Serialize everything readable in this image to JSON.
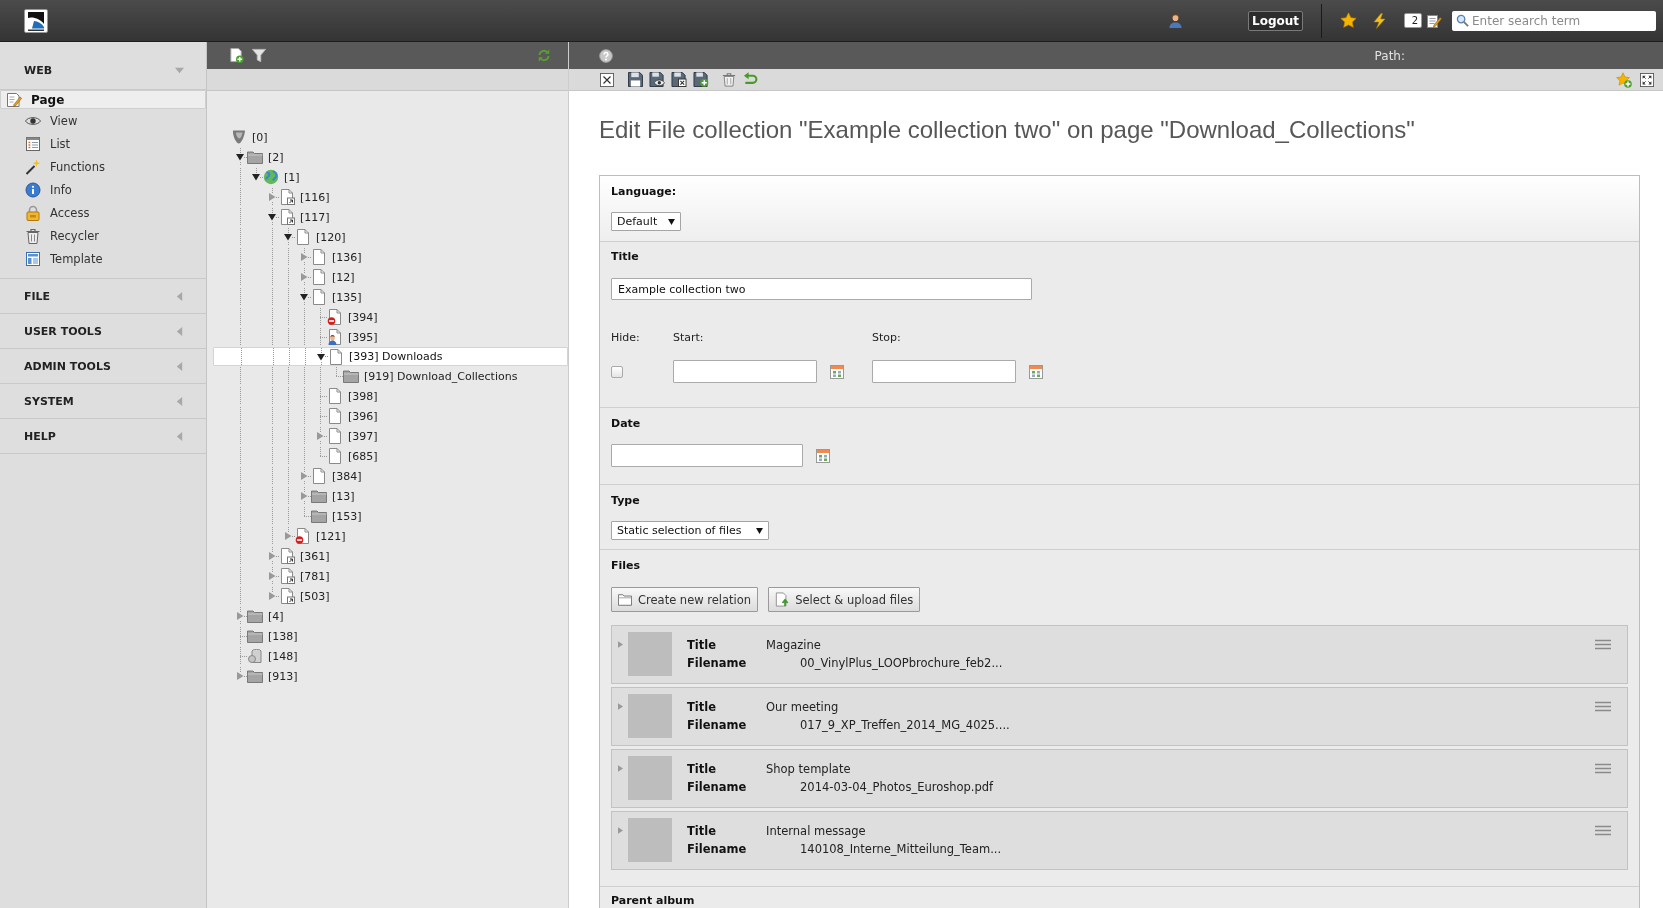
{
  "top_bar": {
    "logout": "Logout",
    "count": "2",
    "search": {
      "placeholder": "Enter search term"
    }
  },
  "modules": [
    {
      "label": "WEB",
      "expanded": true,
      "items": [
        {
          "label": "Page",
          "kind": "page-edit",
          "selected": true
        },
        {
          "label": "View",
          "kind": "eye",
          "selected": false
        },
        {
          "label": "List",
          "kind": "list",
          "selected": false
        },
        {
          "label": "Functions",
          "kind": "wand",
          "selected": false
        },
        {
          "label": "Info",
          "kind": "info",
          "selected": false
        },
        {
          "label": "Access",
          "kind": "lock",
          "selected": false
        },
        {
          "label": "Recycler",
          "kind": "trash",
          "selected": false
        },
        {
          "label": "Template",
          "kind": "template",
          "selected": false
        }
      ]
    },
    {
      "label": "FILE",
      "expanded": false
    },
    {
      "label": "USER TOOLS",
      "expanded": false
    },
    {
      "label": "ADMIN TOOLS",
      "expanded": false
    },
    {
      "label": "SYSTEM",
      "expanded": false
    },
    {
      "label": "HELP",
      "expanded": false
    }
  ],
  "tree": [
    {
      "label": "[0]",
      "kind": "root",
      "selected": false,
      "children": [
        {
          "label": "[2]",
          "kind": "folder",
          "expanded": true,
          "selected": false,
          "children": [
            {
              "label": "[1]",
              "kind": "globe",
              "expanded": true,
              "selected": false,
              "children": [
                {
                  "label": "[116]",
                  "kind": "shortcut",
                  "expanded": false,
                  "selected": false
                },
                {
                  "label": "[117]",
                  "kind": "shortcut",
                  "expanded": true,
                  "selected": false,
                  "children": [
                    {
                      "label": "[120]",
                      "kind": "page",
                      "expanded": true,
                      "selected": false,
                      "children": [
                        {
                          "label": "[136]",
                          "kind": "page",
                          "expanded": false,
                          "selected": false
                        },
                        {
                          "label": "[12]",
                          "kind": "page",
                          "expanded": false,
                          "selected": false
                        },
                        {
                          "label": "[135]",
                          "kind": "page",
                          "expanded": true,
                          "selected": false,
                          "children": [
                            {
                              "label": "[394]",
                              "kind": "hidden-page",
                              "selected": false
                            },
                            {
                              "label": "[395]",
                              "kind": "user-page",
                              "selected": false
                            },
                            {
                              "label": "[393] Downloads",
                              "kind": "page",
                              "expanded": true,
                              "selected": true,
                              "children": [
                                {
                                  "label": "[919] Download_Collections",
                                  "kind": "folder",
                                  "selected": false
                                }
                              ]
                            },
                            {
                              "label": "[398]",
                              "kind": "page",
                              "selected": false
                            },
                            {
                              "label": "[396]",
                              "kind": "page",
                              "selected": false
                            },
                            {
                              "label": "[397]",
                              "kind": "page",
                              "expanded": false,
                              "selected": false
                            },
                            {
                              "label": "[685]",
                              "kind": "page",
                              "selected": false
                            }
                          ]
                        },
                        {
                          "label": "[384]",
                          "kind": "page",
                          "expanded": false,
                          "selected": false
                        },
                        {
                          "label": "[13]",
                          "kind": "folder",
                          "expanded": false,
                          "selected": false
                        },
                        {
                          "label": "[153]",
                          "kind": "folder",
                          "selected": false
                        }
                      ]
                    },
                    {
                      "label": "[121]",
                      "kind": "hidden-page",
                      "expanded": false,
                      "selected": false
                    }
                  ]
                },
                {
                  "label": "[361]",
                  "kind": "shortcut",
                  "expanded": false,
                  "selected": false
                },
                {
                  "label": "[781]",
                  "kind": "shortcut",
                  "expanded": false,
                  "selected": false
                },
                {
                  "label": "[503]",
                  "kind": "shortcut",
                  "expanded": false,
                  "selected": false
                }
              ]
            }
          ]
        },
        {
          "label": "[4]",
          "kind": "folder",
          "expanded": false,
          "selected": false
        },
        {
          "label": "[138]",
          "kind": "folder",
          "selected": false
        },
        {
          "label": "[148]",
          "kind": "recycler",
          "selected": false
        },
        {
          "label": "[913]",
          "kind": "folder",
          "expanded": false,
          "selected": false
        }
      ]
    }
  ],
  "doc_header": {
    "path_label": "Path:"
  },
  "heading": "Edit File collection \"Example collection two\" on page \"Download_Collections\"",
  "form": {
    "language": {
      "label": "Language:",
      "value": "Default"
    },
    "title": {
      "label": "Title",
      "value": "Example collection two"
    },
    "hide": {
      "label": "Hide:",
      "checked": false
    },
    "start": {
      "label": "Start:"
    },
    "stop": {
      "label": "Stop:"
    },
    "date": {
      "label": "Date"
    },
    "type": {
      "label": "Type",
      "value": "Static selection of files"
    },
    "files": {
      "label": "Files",
      "buttons": [
        {
          "label": "Create new relation",
          "kind": "folder"
        },
        {
          "label": "Select & upload files",
          "kind": "upload"
        }
      ],
      "items": [
        {
          "expanded": false,
          "title_label": "Title",
          "title": "Magazine",
          "filename_label": "Filename",
          "filename": "00_VinylPlus_LOOPbrochure_feb2..."
        },
        {
          "expanded": false,
          "title_label": "Title",
          "title": "Our meeting",
          "filename_label": "Filename",
          "filename": "017_9_XP_Treffen_2014_MG_4025...."
        },
        {
          "expanded": false,
          "title_label": "Title",
          "title": "Shop template",
          "filename_label": "Filename",
          "filename": "2014-03-04_Photos_Euroshop.pdf"
        },
        {
          "expanded": false,
          "title_label": "Title",
          "title": "Internal message",
          "filename_label": "Filename",
          "filename": "140108_Interne_Mitteilung_Team..."
        }
      ]
    },
    "parent_album": {
      "label": "Parent album"
    }
  }
}
